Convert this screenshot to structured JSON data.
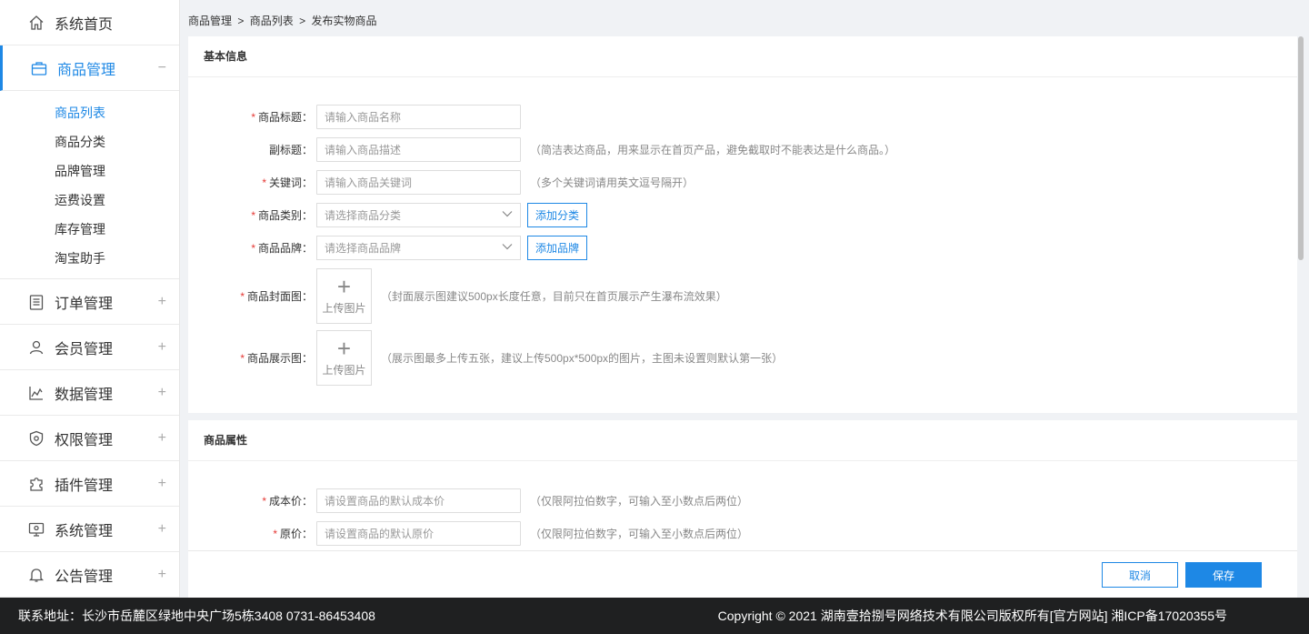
{
  "sidebar": {
    "items": [
      {
        "label": "系统首页",
        "icon": "home-icon",
        "toggle": ""
      },
      {
        "label": "商品管理",
        "icon": "briefcase-icon",
        "toggle": "−"
      },
      {
        "label": "订单管理",
        "icon": "order-list-icon",
        "toggle": "+"
      },
      {
        "label": "会员管理",
        "icon": "member-icon",
        "toggle": "+"
      },
      {
        "label": "数据管理",
        "icon": "chart-icon",
        "toggle": "+"
      },
      {
        "label": "权限管理",
        "icon": "shield-icon",
        "toggle": "+"
      },
      {
        "label": "插件管理",
        "icon": "puzzle-icon",
        "toggle": "+"
      },
      {
        "label": "系统管理",
        "icon": "monitor-icon",
        "toggle": "+"
      },
      {
        "label": "公告管理",
        "icon": "bell-icon",
        "toggle": "+"
      }
    ],
    "sub_items": [
      "商品列表",
      "商品分类",
      "品牌管理",
      "运费设置",
      "库存管理",
      "淘宝助手"
    ]
  },
  "breadcrumb": [
    "商品管理",
    ">",
    "商品列表",
    ">",
    "发布实物商品"
  ],
  "basic": {
    "title": "基本信息",
    "product_title": {
      "label": "商品标题：",
      "placeholder": "请输入商品名称"
    },
    "subtitle": {
      "label": "副标题：",
      "placeholder": "请输入商品描述",
      "hint": "（简洁表达商品，用来显示在首页产品，避免截取时不能表达是什么商品。）"
    },
    "keywords": {
      "label": "关键词：",
      "placeholder": "请输入商品关键词",
      "hint": "（多个关键词请用英文逗号隔开）"
    },
    "category": {
      "label": "商品类别：",
      "value": "请选择商品分类",
      "button": "添加分类"
    },
    "brand": {
      "label": "商品品牌：",
      "value": "请选择商品品牌",
      "button": "添加品牌"
    },
    "cover": {
      "label": "商品封面图：",
      "upload": "上传图片",
      "hint": "（封面展示图建议500px长度任意，目前只在首页展示产生瀑布流效果）"
    },
    "gallery": {
      "label": "商品展示图：",
      "upload": "上传图片",
      "hint": "（展示图最多上传五张，建议上传500px*500px的图片，主图未设置则默认第一张）"
    }
  },
  "attrs": {
    "title": "商品属性",
    "cost": {
      "label": "成本价：",
      "placeholder": "请设置商品的默认成本价",
      "hint": "（仅限阿拉伯数字，可输入至小数点后两位）"
    },
    "original": {
      "label": "原价：",
      "placeholder": "请设置商品的默认原价",
      "hint": "（仅限阿拉伯数字，可输入至小数点后两位）"
    }
  },
  "actions": {
    "cancel": "取消",
    "save": "保存"
  },
  "footer": {
    "address": "联系地址：长沙市岳麓区绿地中央广场5栋3408 0731-86453408",
    "copyright": "Copyright © 2021 湖南壹拾捌号网络技术有限公司版权所有[官方网站]  湘ICP备17020355号"
  },
  "colors": {
    "accent": "#1e88e5",
    "required": "#e53935",
    "footer_bg": "#1f2021"
  }
}
